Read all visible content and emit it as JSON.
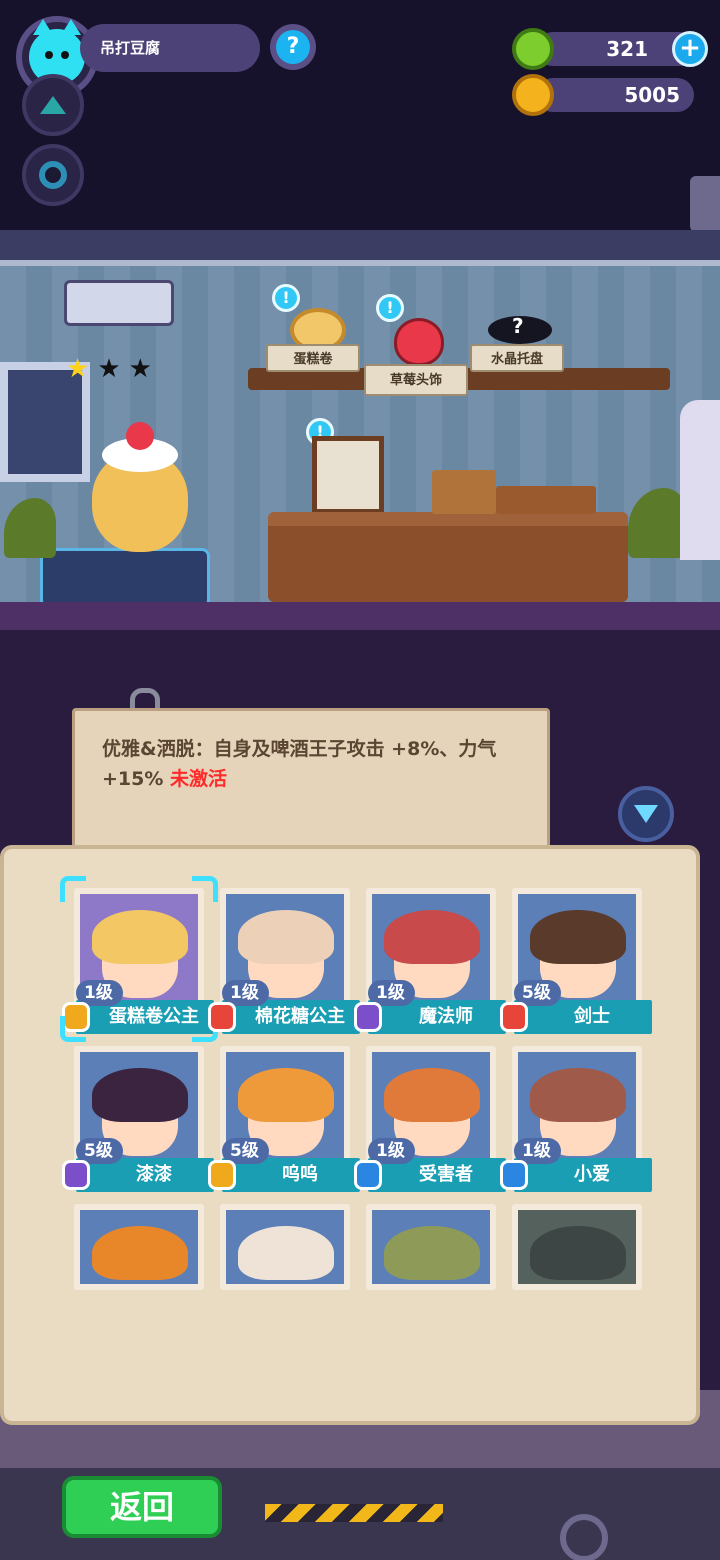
{
  "player": {
    "name": "吊打豆腐",
    "help_icon": "question-mark-icon"
  },
  "resources": {
    "gems": "321",
    "gold": "5005"
  },
  "room": {
    "stars_filled": 1,
    "stars_total": 3,
    "shelf_items": [
      {
        "label": "蛋糕卷"
      },
      {
        "label": "草莓头饰"
      },
      {
        "label": "水晶托盘"
      }
    ]
  },
  "effect_note": {
    "text": "优雅&洒脱：自身及啤酒王子攻击 +8%、力气 +15%",
    "status": "未激活"
  },
  "characters": [
    {
      "level": "1级",
      "name": "蛋糕卷公主",
      "badge_color": "#f0a81c",
      "selected": true
    },
    {
      "level": "1级",
      "name": "棉花糖公主",
      "badge_color": "#e8453a",
      "selected": false
    },
    {
      "level": "1级",
      "name": "魔法师",
      "badge_color": "#7b4fc9",
      "selected": false
    },
    {
      "level": "5级",
      "name": "剑士",
      "badge_color": "#e8453a",
      "selected": false
    },
    {
      "level": "5级",
      "name": "漆漆",
      "badge_color": "#7b4fc9",
      "selected": false
    },
    {
      "level": "5级",
      "name": "呜呜",
      "badge_color": "#f0a81c",
      "selected": false
    },
    {
      "level": "1级",
      "name": "受害者",
      "badge_color": "#2a86e0",
      "selected": false
    },
    {
      "level": "1级",
      "name": "小爱",
      "badge_color": "#2a86e0",
      "selected": false
    }
  ],
  "bottom": {
    "back_label": "返回"
  }
}
